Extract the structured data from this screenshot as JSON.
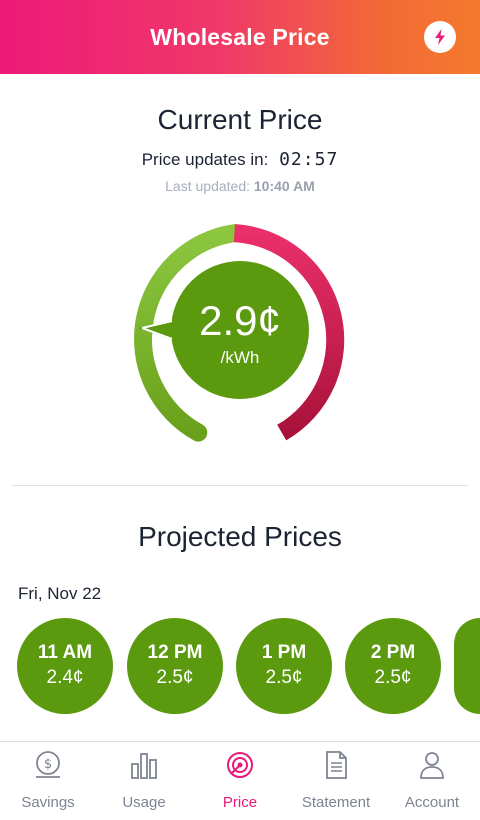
{
  "header": {
    "title": "Wholesale Price",
    "action_icon": "lightning-bolt-icon"
  },
  "current": {
    "title": "Current Price",
    "updates_label": "Price updates in:",
    "countdown": "02:57",
    "last_updated_label": "Last updated:",
    "last_updated_time": "10:40 AM",
    "price": "2.9¢",
    "unit": "/kWh",
    "gauge_level": 0.22
  },
  "projected": {
    "title": "Projected Prices",
    "date": "Fri, Nov 22",
    "items": [
      {
        "time": "11 AM",
        "price": "2.4¢"
      },
      {
        "time": "12 PM",
        "price": "2.5¢"
      },
      {
        "time": "1 PM",
        "price": "2.5¢"
      },
      {
        "time": "2 PM",
        "price": "2.5¢"
      }
    ]
  },
  "tabs": [
    {
      "label": "Savings",
      "icon": "savings-coin-icon",
      "active": false
    },
    {
      "label": "Usage",
      "icon": "bar-chart-icon",
      "active": false
    },
    {
      "label": "Price",
      "icon": "price-dial-icon",
      "active": true
    },
    {
      "label": "Statement",
      "icon": "document-icon",
      "active": false
    },
    {
      "label": "Account",
      "icon": "person-icon",
      "active": false
    }
  ],
  "colors": {
    "header_start": "#ec1a78",
    "header_end": "#f47a2c",
    "price_green": "#5b9a0e",
    "gauge_red": "#e0245e",
    "active_tab": "#e8197a"
  }
}
